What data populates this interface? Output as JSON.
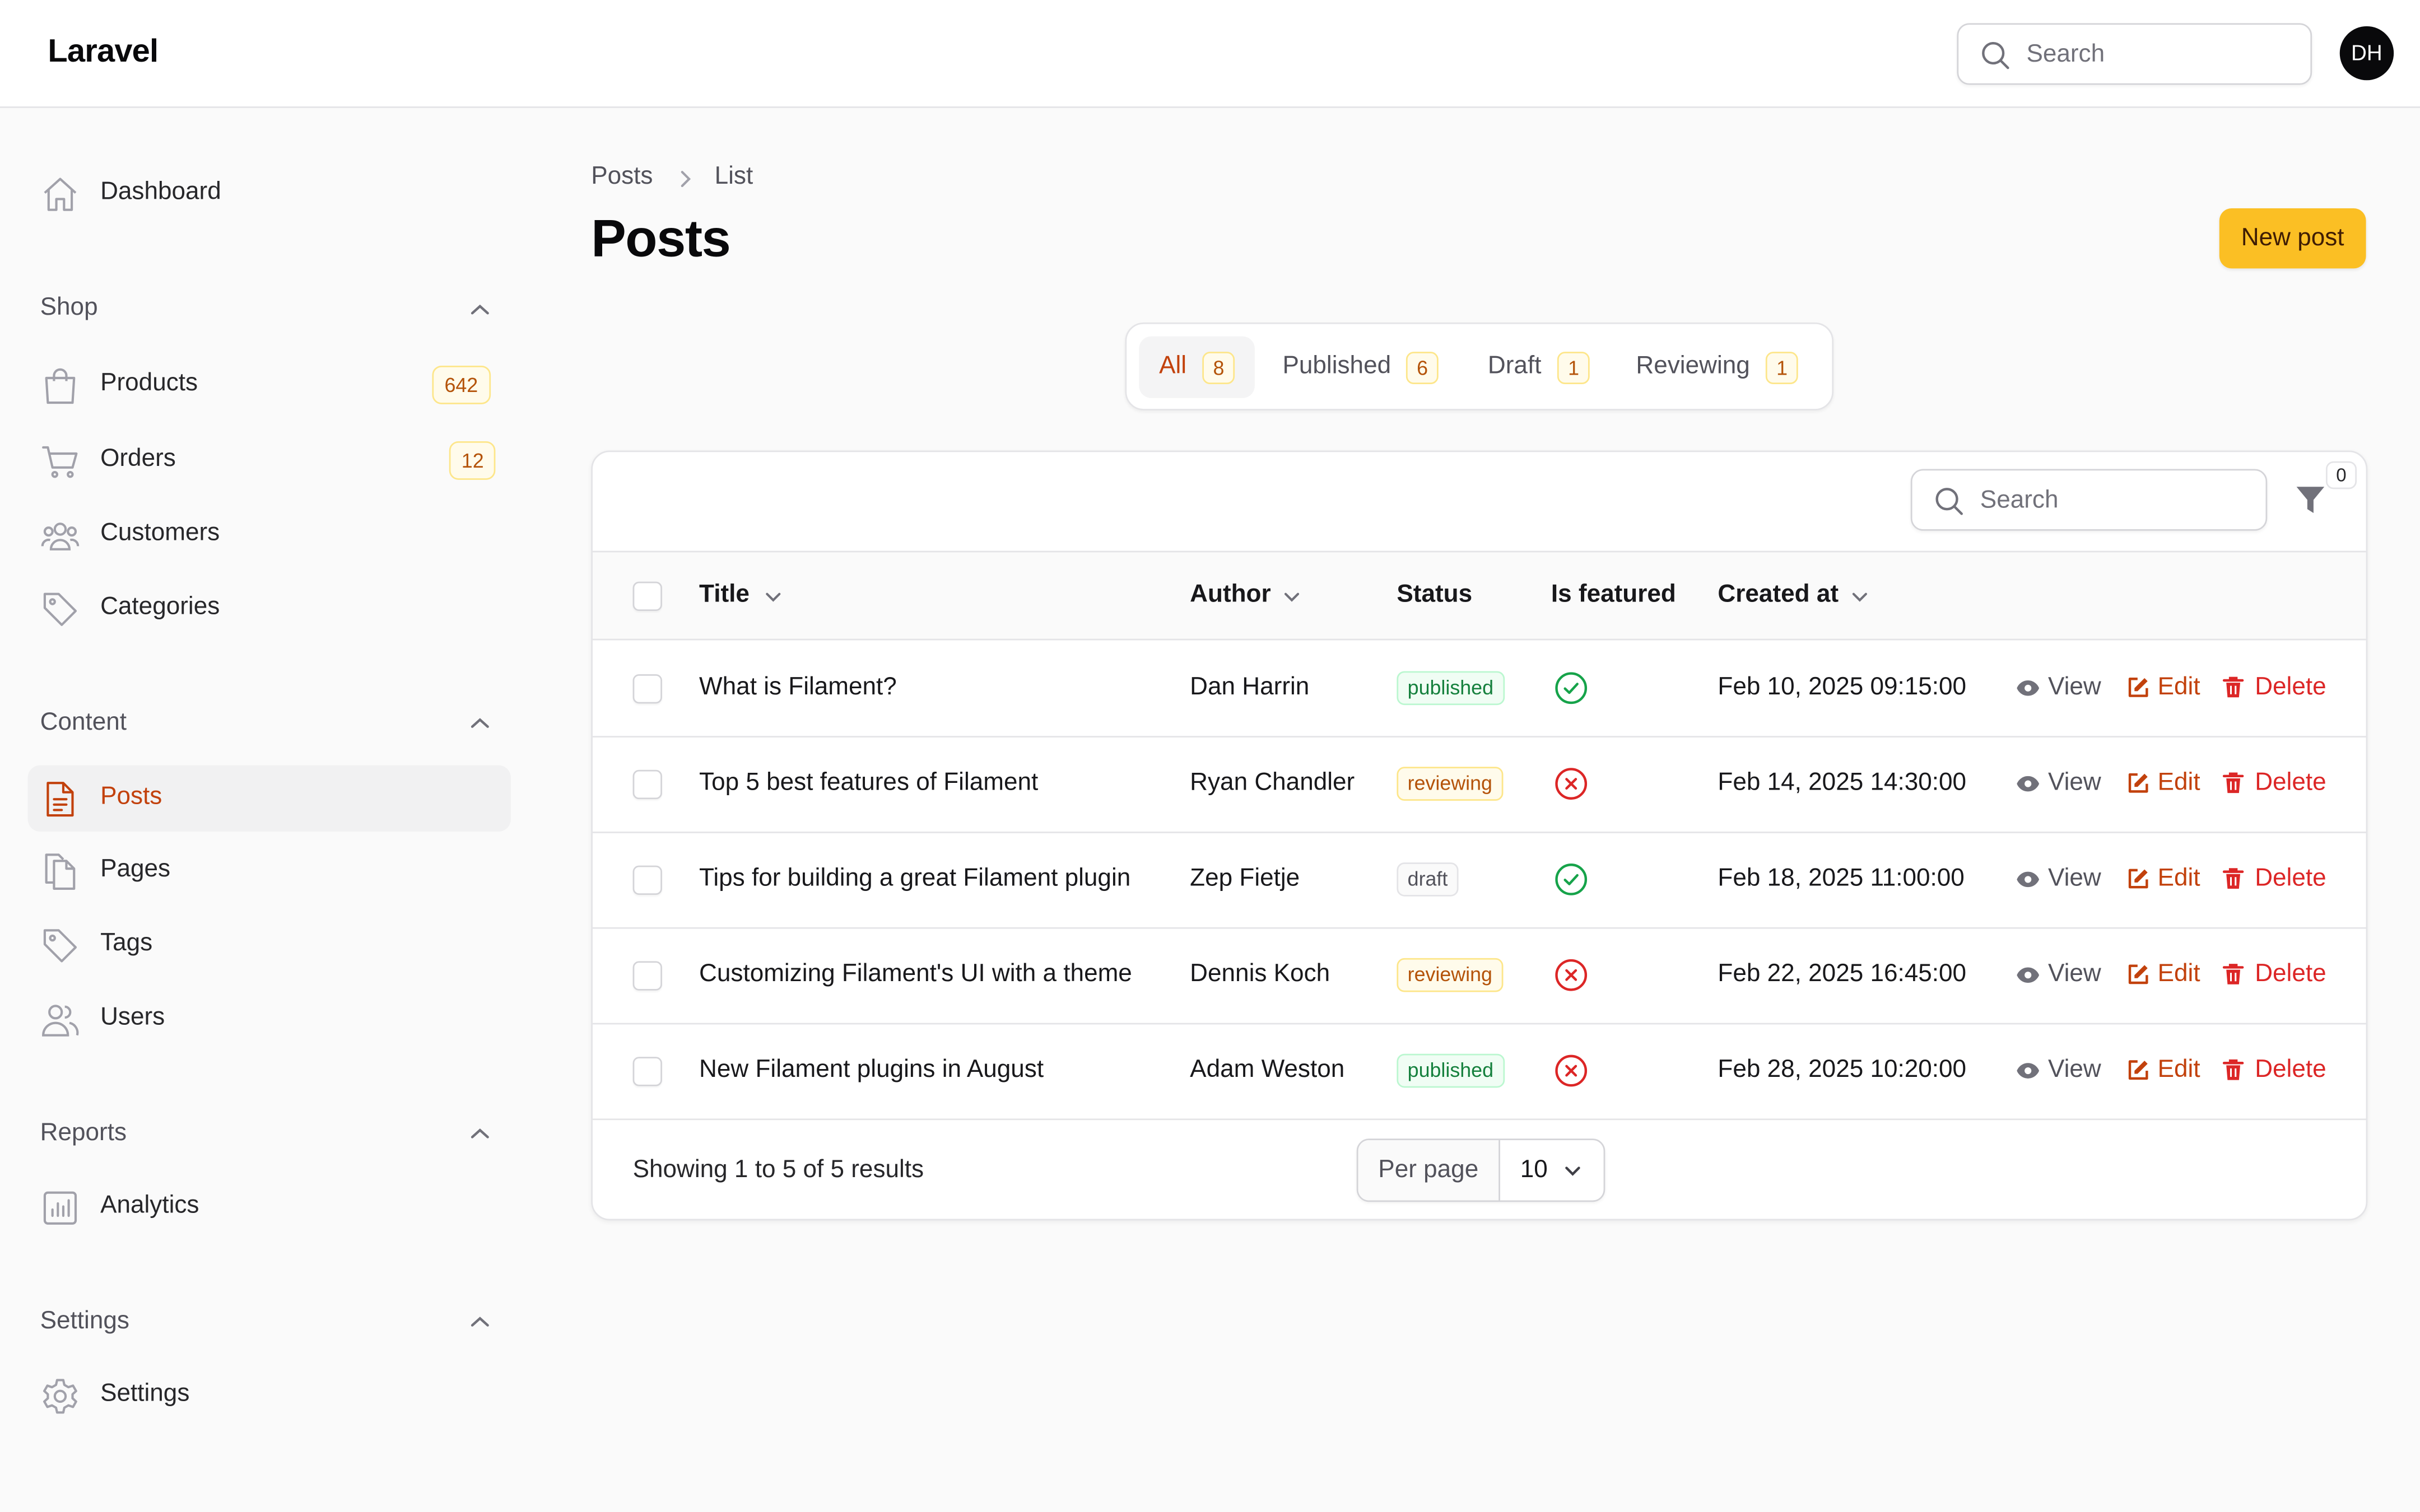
{
  "app": {
    "brand": "Laravel",
    "search_placeholder": "Search",
    "avatar_initials": "DH"
  },
  "sidebar": {
    "dashboard": "Dashboard",
    "groups": {
      "shop": "Shop",
      "content": "Content",
      "reports": "Reports",
      "settings": "Settings"
    },
    "items": {
      "products": {
        "label": "Products",
        "badge": "642"
      },
      "orders": {
        "label": "Orders",
        "badge": "12"
      },
      "customers": {
        "label": "Customers"
      },
      "categories": {
        "label": "Categories"
      },
      "posts": {
        "label": "Posts",
        "active": true
      },
      "pages": {
        "label": "Pages"
      },
      "tags": {
        "label": "Tags"
      },
      "users": {
        "label": "Users"
      },
      "analytics": {
        "label": "Analytics"
      },
      "settings": {
        "label": "Settings"
      }
    }
  },
  "breadcrumb": {
    "first": "Posts",
    "second": "List"
  },
  "page": {
    "title": "Posts",
    "new_button": "New post"
  },
  "tabs": [
    {
      "label": "All",
      "count": "8",
      "active": true
    },
    {
      "label": "Published",
      "count": "6"
    },
    {
      "label": "Draft",
      "count": "1"
    },
    {
      "label": "Reviewing",
      "count": "1"
    }
  ],
  "table": {
    "search_placeholder": "Search",
    "filter_count": "0",
    "columns": {
      "title": "Title",
      "author": "Author",
      "status": "Status",
      "featured": "Is featured",
      "created": "Created at"
    },
    "actions": {
      "view": "View",
      "edit": "Edit",
      "delete": "Delete"
    },
    "rows": [
      {
        "title": "What is Filament?",
        "author": "Dan Harrin",
        "status": "published",
        "featured": true,
        "created": "Feb 10, 2025 09:15:00"
      },
      {
        "title": "Top 5 best features of Filament",
        "author": "Ryan Chandler",
        "status": "reviewing",
        "featured": false,
        "created": "Feb 14, 2025 14:30:00"
      },
      {
        "title": "Tips for building a great Filament plugin",
        "author": "Zep Fietje",
        "status": "draft",
        "featured": true,
        "created": "Feb 18, 2025 11:00:00"
      },
      {
        "title": "Customizing Filament's UI with a theme",
        "author": "Dennis Koch",
        "status": "reviewing",
        "featured": false,
        "created": "Feb 22, 2025 16:45:00"
      },
      {
        "title": "New Filament plugins in August",
        "author": "Adam Weston",
        "status": "published",
        "featured": false,
        "created": "Feb 28, 2025 10:20:00"
      }
    ],
    "footer": {
      "summary": "Showing 1 to 5 of 5 results",
      "per_page_label": "Per page",
      "per_page_value": "10"
    }
  },
  "colors": {
    "accent": "#c2410c",
    "primary_button": "#fbbf24",
    "success": "#16a34a",
    "danger": "#dc2626"
  }
}
